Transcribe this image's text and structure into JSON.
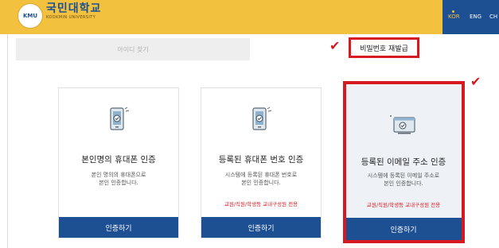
{
  "header": {
    "logo_mark": "KMU",
    "logo_kr": "국민대학교",
    "logo_en": "KOOKMIN UNIVERSITY",
    "languages": [
      "KOR",
      "ENG",
      "CH"
    ]
  },
  "tabs": {
    "find_id": "아이디 찾기",
    "reset_password": "비밀번호 재발급"
  },
  "cards": [
    {
      "title": "본인명의 휴대폰 인증",
      "desc": [
        "본인 명의의 휴대폰으로",
        "본인 인증합니다."
      ],
      "note": "",
      "button": "인증하기",
      "icon": "phone-verify-icon"
    },
    {
      "title": "등록된 휴대폰 번호 인증",
      "desc": [
        "시스템에 등록된 휴대폰 번호로",
        "본인 인증합니다."
      ],
      "note": "교원/직원/학생등 교내구성원 전용",
      "button": "인증하기",
      "icon": "phone-verify-icon"
    },
    {
      "title": "등록된 이메일 주소 인증",
      "desc": [
        "시스템에 등록된 이메일 주소로",
        "본인 인증합니다."
      ],
      "note": "교원/직원/학생등 교내구성원 전용",
      "button": "인증하기",
      "icon": "email-verify-icon"
    }
  ],
  "colors": {
    "header_yellow": "#f2c13e",
    "brand_blue": "#1d4f93",
    "highlight_red": "#d71920"
  }
}
